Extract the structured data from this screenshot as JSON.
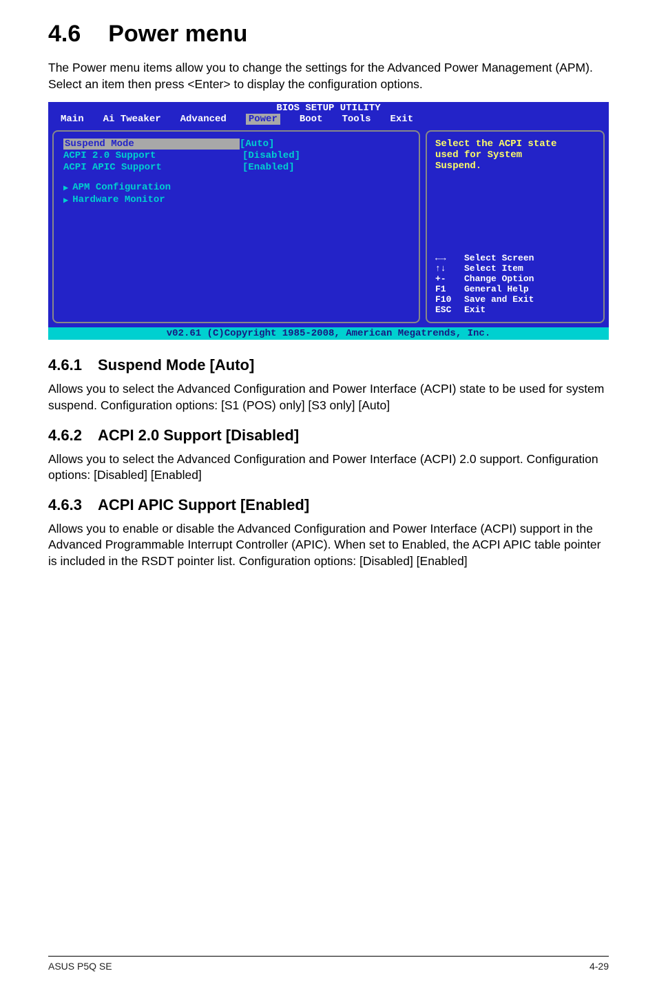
{
  "section": {
    "number": "4.6",
    "title": "Power menu",
    "intro": "The Power menu items allow you to change the settings for the Advanced Power Management (APM). Select an item then press <Enter> to display the configuration options."
  },
  "bios": {
    "header": "BIOS SETUP UTILITY",
    "tabs": [
      "Main",
      "Ai Tweaker",
      "Advanced",
      "Power",
      "Boot",
      "Tools",
      "Exit"
    ],
    "selected_tab": "Power",
    "options": [
      {
        "label": "Suspend Mode",
        "value": "[Auto]",
        "highlight": true
      },
      {
        "label": "ACPI 2.0 Support",
        "value": "[Disabled]"
      },
      {
        "label": "ACPI APIC Support",
        "value": "[Enabled]"
      }
    ],
    "submenus": [
      "APM Configuration",
      "Hardware Monitor"
    ],
    "help_text_line1": "Select the ACPI state",
    "help_text_line2": "used for System",
    "help_text_line3": "Suspend.",
    "keyhelp": [
      {
        "key": "←→",
        "desc": "Select Screen"
      },
      {
        "key": "↑↓",
        "desc": "Select Item"
      },
      {
        "key": "+-",
        "desc": "Change Option"
      },
      {
        "key": "F1",
        "desc": "General Help"
      },
      {
        "key": "F10",
        "desc": "Save and Exit"
      },
      {
        "key": "ESC",
        "desc": "Exit"
      }
    ],
    "footer": "v02.61 (C)Copyright 1985-2008, American Megatrends, Inc."
  },
  "subsections": [
    {
      "number": "4.6.1",
      "title": "Suspend Mode [Auto]",
      "body": "Allows you to select the Advanced Configuration and Power Interface (ACPI) state to be used for system suspend. Configuration options: [S1 (POS) only] [S3 only] [Auto]"
    },
    {
      "number": "4.6.2",
      "title": "ACPI 2.0 Support [Disabled]",
      "body": "Allows you to select the Advanced Configuration and Power Interface (ACPI) 2.0 support. Configuration options: [Disabled] [Enabled]"
    },
    {
      "number": "4.6.3",
      "title": "ACPI APIC Support [Enabled]",
      "body": "Allows you to enable or disable the Advanced Configuration and Power Interface (ACPI) support in the Advanced Programmable Interrupt Controller (APIC). When set to Enabled, the ACPI APIC table pointer is included in the RSDT pointer list. Configuration options: [Disabled] [Enabled]"
    }
  ],
  "footer": {
    "left": "ASUS P5Q SE",
    "right": "4-29"
  }
}
